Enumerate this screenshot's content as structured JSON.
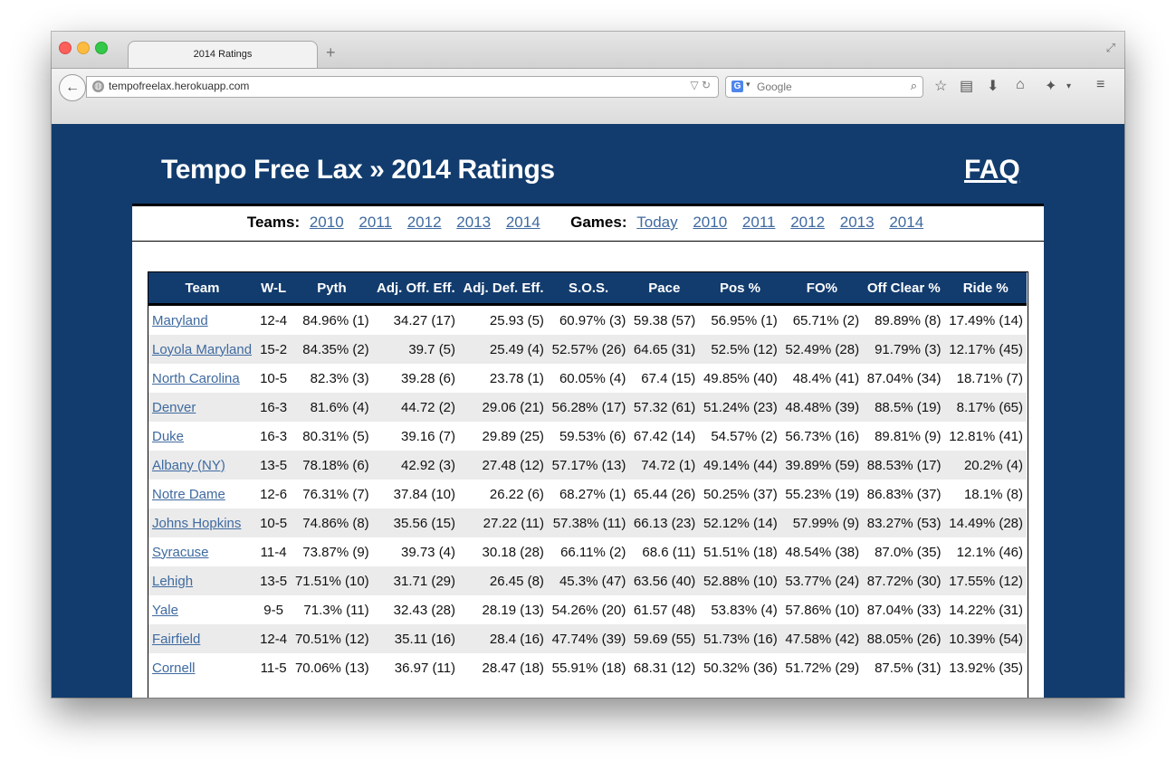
{
  "browser": {
    "tab_title": "2014 Ratings",
    "url": "tempofreelax.herokuapp.com",
    "search_placeholder": "Google",
    "new_tab_glyph": "+",
    "search_engine_icon": "G"
  },
  "site": {
    "title": "Tempo Free Lax » 2014 Ratings",
    "faq": "FAQ"
  },
  "nav": {
    "teams_label": "Teams:",
    "teams_links": [
      "2010",
      "2011",
      "2012",
      "2013",
      "2014"
    ],
    "games_label": "Games:",
    "games_links": [
      "Today",
      "2010",
      "2011",
      "2012",
      "2013",
      "2014"
    ]
  },
  "table": {
    "headers": [
      "Team",
      "W-L",
      "Pyth",
      "Adj. Off. Eff.",
      "Adj. Def. Eff.",
      "S.O.S.",
      "Pace",
      "Pos %",
      "FO%",
      "Off Clear %",
      "Ride %"
    ],
    "rows": [
      [
        "Maryland",
        "12-4",
        "84.96% (1)",
        "34.27 (17)",
        "25.93 (5)",
        "60.97% (3)",
        "59.38 (57)",
        "56.95% (1)",
        "65.71% (2)",
        "89.89% (8)",
        "17.49% (14)"
      ],
      [
        "Loyola Maryland",
        "15-2",
        "84.35% (2)",
        "39.7 (5)",
        "25.49 (4)",
        "52.57% (26)",
        "64.65 (31)",
        "52.5% (12)",
        "52.49% (28)",
        "91.79% (3)",
        "12.17% (45)"
      ],
      [
        "North Carolina",
        "10-5",
        "82.3% (3)",
        "39.28 (6)",
        "23.78 (1)",
        "60.05% (4)",
        "67.4 (15)",
        "49.85% (40)",
        "48.4% (41)",
        "87.04% (34)",
        "18.71% (7)"
      ],
      [
        "Denver",
        "16-3",
        "81.6% (4)",
        "44.72 (2)",
        "29.06 (21)",
        "56.28% (17)",
        "57.32 (61)",
        "51.24% (23)",
        "48.48% (39)",
        "88.5% (19)",
        "8.17% (65)"
      ],
      [
        "Duke",
        "16-3",
        "80.31% (5)",
        "39.16 (7)",
        "29.89 (25)",
        "59.53% (6)",
        "67.42 (14)",
        "54.57% (2)",
        "56.73% (16)",
        "89.81% (9)",
        "12.81% (41)"
      ],
      [
        "Albany (NY)",
        "13-5",
        "78.18% (6)",
        "42.92 (3)",
        "27.48 (12)",
        "57.17% (13)",
        "74.72 (1)",
        "49.14% (44)",
        "39.89% (59)",
        "88.53% (17)",
        "20.2% (4)"
      ],
      [
        "Notre Dame",
        "12-6",
        "76.31% (7)",
        "37.84 (10)",
        "26.22 (6)",
        "68.27% (1)",
        "65.44 (26)",
        "50.25% (37)",
        "55.23% (19)",
        "86.83% (37)",
        "18.1% (8)"
      ],
      [
        "Johns Hopkins",
        "10-5",
        "74.86% (8)",
        "35.56 (15)",
        "27.22 (11)",
        "57.38% (11)",
        "66.13 (23)",
        "52.12% (14)",
        "57.99% (9)",
        "83.27% (53)",
        "14.49% (28)"
      ],
      [
        "Syracuse",
        "11-4",
        "73.87% (9)",
        "39.73 (4)",
        "30.18 (28)",
        "66.11% (2)",
        "68.6 (11)",
        "51.51% (18)",
        "48.54% (38)",
        "87.0% (35)",
        "12.1% (46)"
      ],
      [
        "Lehigh",
        "13-5",
        "71.51% (10)",
        "31.71 (29)",
        "26.45 (8)",
        "45.3% (47)",
        "63.56 (40)",
        "52.88% (10)",
        "53.77% (24)",
        "87.72% (30)",
        "17.55% (12)"
      ],
      [
        "Yale",
        "9-5",
        "71.3% (11)",
        "32.43 (28)",
        "28.19 (13)",
        "54.26% (20)",
        "61.57 (48)",
        "53.83% (4)",
        "57.86% (10)",
        "87.04% (33)",
        "14.22% (31)"
      ],
      [
        "Fairfield",
        "12-4",
        "70.51% (12)",
        "35.11 (16)",
        "28.4 (16)",
        "47.74% (39)",
        "59.69 (55)",
        "51.73% (16)",
        "47.58% (42)",
        "88.05% (26)",
        "10.39% (54)"
      ],
      [
        "Cornell",
        "11-5",
        "70.06% (13)",
        "36.97 (11)",
        "28.47 (18)",
        "55.91% (18)",
        "68.31 (12)",
        "50.32% (36)",
        "51.72% (29)",
        "87.5% (31)",
        "13.92% (35)"
      ]
    ]
  }
}
